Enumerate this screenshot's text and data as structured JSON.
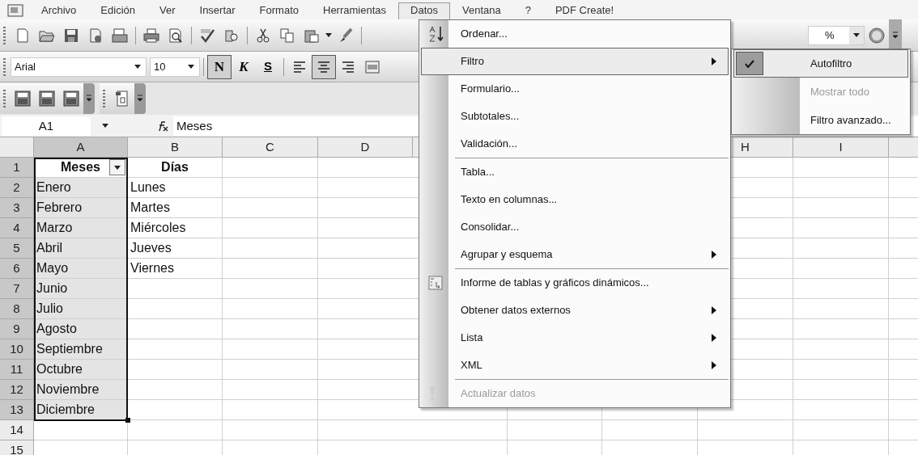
{
  "menu_bar": [
    {
      "label": "Archivo",
      "selected": false
    },
    {
      "label": "Edición",
      "selected": false
    },
    {
      "label": "Ver",
      "selected": false
    },
    {
      "label": "Insertar",
      "selected": false
    },
    {
      "label": "Formato",
      "selected": false
    },
    {
      "label": "Herramientas",
      "selected": false
    },
    {
      "label": "Datos",
      "selected": true
    },
    {
      "label": "Ventana",
      "selected": false
    },
    {
      "label": "?",
      "selected": false
    },
    {
      "label": "PDF Create!",
      "selected": false
    }
  ],
  "standard_toolbar": {
    "zoom": "%"
  },
  "formatting_toolbar": {
    "font": "Arial",
    "size": "10",
    "style_buttons": [
      {
        "label": "N",
        "pressed": true
      },
      {
        "label": "K",
        "pressed": false
      },
      {
        "label": "S",
        "pressed": false
      }
    ],
    "align_buttons": [
      {
        "pressed": false
      },
      {
        "pressed": true
      },
      {
        "pressed": false
      },
      {
        "pressed": false
      }
    ]
  },
  "formula_bar": {
    "name_box": "A1",
    "formula": "Meses"
  },
  "sheet": {
    "columns": [
      {
        "label": "A",
        "selected": true,
        "autofilter": true
      },
      {
        "label": "B",
        "selected": false,
        "autofilter": false
      },
      {
        "label": "C",
        "selected": false,
        "autofilter": false
      },
      {
        "label": "D",
        "selected": false,
        "autofilter": false
      },
      {
        "label": "H",
        "selected": false,
        "autofilter": false
      },
      {
        "label": "I",
        "selected": false,
        "autofilter": false
      }
    ],
    "rows": [
      {
        "number": "1",
        "selected": true,
        "kind": "header",
        "cells": [
          "Meses",
          "Días"
        ]
      },
      {
        "number": "2",
        "selected": true,
        "kind": "data",
        "cells": [
          "Enero",
          "Lunes"
        ]
      },
      {
        "number": "3",
        "selected": true,
        "kind": "data",
        "cells": [
          "Febrero",
          "Martes"
        ]
      },
      {
        "number": "4",
        "selected": true,
        "kind": "data",
        "cells": [
          "Marzo",
          "Miércoles"
        ]
      },
      {
        "number": "5",
        "selected": true,
        "kind": "data",
        "cells": [
          "Abril",
          "Jueves"
        ]
      },
      {
        "number": "6",
        "selected": true,
        "kind": "data",
        "cells": [
          "Mayo",
          "Viernes"
        ]
      },
      {
        "number": "7",
        "selected": true,
        "kind": "data",
        "cells": [
          "Junio"
        ]
      },
      {
        "number": "8",
        "selected": true,
        "kind": "data",
        "cells": [
          "Julio"
        ]
      },
      {
        "number": "9",
        "selected": true,
        "kind": "data",
        "cells": [
          "Agosto"
        ]
      },
      {
        "number": "10",
        "selected": true,
        "kind": "data",
        "cells": [
          "Septiembre"
        ]
      },
      {
        "number": "11",
        "selected": true,
        "kind": "data",
        "cells": [
          "Octubre"
        ]
      },
      {
        "number": "12",
        "selected": true,
        "kind": "data",
        "cells": [
          "Noviembre"
        ]
      },
      {
        "number": "13",
        "selected": true,
        "kind": "data",
        "cells": [
          "Diciembre"
        ]
      },
      {
        "number": "14",
        "selected": false
      },
      {
        "number": "15",
        "selected": false
      }
    ]
  },
  "data_menu": {
    "items": [
      {
        "label": "Ordenar...",
        "submenu": false,
        "disabled": false,
        "selected": false,
        "separator_before": false
      },
      {
        "label": "Filtro",
        "submenu": true,
        "disabled": false,
        "selected": true,
        "separator_before": false
      },
      {
        "label": "Formulario...",
        "submenu": false,
        "disabled": false,
        "selected": false,
        "separator_before": false
      },
      {
        "label": "Subtotales...",
        "submenu": false,
        "disabled": false,
        "selected": false,
        "separator_before": false
      },
      {
        "label": "Validación...",
        "submenu": false,
        "disabled": false,
        "selected": false,
        "separator_before": false
      },
      {
        "label": "Tabla...",
        "submenu": false,
        "disabled": false,
        "selected": false,
        "separator_before": true
      },
      {
        "label": "Texto en columnas...",
        "submenu": false,
        "disabled": false,
        "selected": false,
        "separator_before": false
      },
      {
        "label": "Consolidar...",
        "submenu": false,
        "disabled": false,
        "selected": false,
        "separator_before": false
      },
      {
        "label": "Agrupar y esquema",
        "submenu": true,
        "disabled": false,
        "selected": false,
        "separator_before": false
      },
      {
        "label": "Informe de tablas y gráficos dinámicos...",
        "submenu": false,
        "disabled": false,
        "selected": false,
        "separator_before": true
      },
      {
        "label": "Obtener datos externos",
        "submenu": true,
        "disabled": false,
        "selected": false,
        "separator_before": false
      },
      {
        "label": "Lista",
        "submenu": true,
        "disabled": false,
        "selected": false,
        "separator_before": false
      },
      {
        "label": "XML",
        "submenu": true,
        "disabled": false,
        "selected": false,
        "separator_before": false
      },
      {
        "label": "Actualizar datos",
        "submenu": false,
        "disabled": true,
        "selected": false,
        "separator_before": true
      }
    ]
  },
  "filter_submenu": {
    "items": [
      {
        "label": "Autofiltro",
        "checked": true,
        "disabled": false,
        "selected": true
      },
      {
        "label": "Mostrar todo",
        "checked": false,
        "disabled": true,
        "selected": false
      },
      {
        "label": "Filtro avanzado...",
        "checked": false,
        "disabled": false,
        "selected": false
      }
    ]
  }
}
